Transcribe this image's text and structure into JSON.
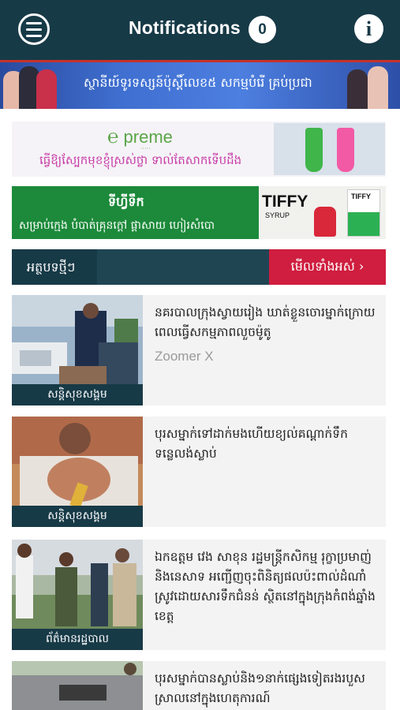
{
  "header": {
    "title": "Notifications",
    "badge_count": "0"
  },
  "top_banner": {
    "text": "ស្ថានីយ៍ទូរទស្សន៍ប៉ុស្តិ៍លេខ៥ សកម្មបំរើ គ្រប់ប្រជា",
    "colors": {
      "background": "#3f6fd0",
      "stripe": "#c7322a"
    }
  },
  "ad_preme": {
    "logo": "preme",
    "tagline": "ធ្វើឱ្យស្បែកមុខខ្ញុំស្រស់ថ្លា ទាល់តែសាកទើបដឹង"
  },
  "ad_tiffy": {
    "name": "ទីហ្វីទឹក",
    "description": "សម្រាប់ក្មេង បំបាត់គ្រុនក្តៅ ផ្តាសាយ ហៀរសំបោ",
    "brand": "TIFFY",
    "brand_sub": "SYRUP",
    "box_label": "TIFFY"
  },
  "section": {
    "label": "អត្ថបទថ្មីៗ",
    "see_all": "មើលទាំងអស់ ›"
  },
  "articles": [
    {
      "headline": "នគរបាលក្រុងស្វាយរៀង ឃាត់ខ្លួនចោរម្នាក់ក្រោយពេលធ្វើសកម្មភាពលួចម៉ូតូ",
      "source": "Zoomer X",
      "category": "សន្តិសុខសង្គម"
    },
    {
      "headline": "បុរសម្នាក់ទៅដាក់មងហើយខ្យល់គណ្ដាក់ទឹកទន្លេលង់ស្លាប់",
      "category": "សន្តិសុខសង្គម"
    },
    {
      "headline": "ឯកឧត្តម វេង សាខុន រដ្ឋមន្ត្រីកសិកម្ម រុក្ខាប្រមាញ់និងនេសាទ អញ្ជើញចុះពិនិត្យផលប៉ះពាល់ដំណាំស្រូវដោយសារទឹកជំនន់ ស្ថិតនៅក្នុងក្រុងកំពង់ឆ្នាំង ខេត្ត",
      "category": "ព័ត៌មានរដ្ឋបាល"
    },
    {
      "headline": "បុរសម្នាក់បានស្លាប់និង១នាក់ផ្សេងទៀតរងរបួសស្រាលនៅក្នុងហេតុការណ៍"
    }
  ],
  "colors": {
    "header_bg": "#173a47",
    "see_all_bg": "#cf1e3f",
    "tiffy_green": "#1c8a3a"
  }
}
